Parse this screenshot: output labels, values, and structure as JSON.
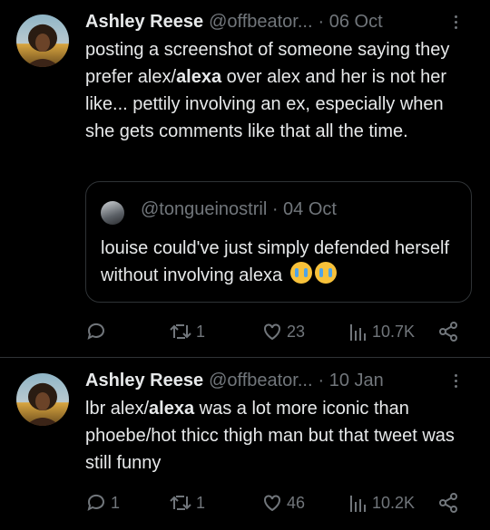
{
  "tweets": [
    {
      "author_name": "Ashley Reese",
      "author_handle": "@offbeator...",
      "date": "· 06 Oct",
      "text_parts": [
        "posting a screenshot of someone saying they prefer alex/",
        "alexa",
        " over alex and her is not her like... pettily involving an ex, especially when she gets comments like that all the time."
      ],
      "quoted": {
        "handle": "@tongueinostril",
        "date": "· 04 Oct",
        "text": "louise could've just simply defended herself without involving alexa",
        "emoji": "loudly-crying-face"
      },
      "actions": {
        "replies": "",
        "retweets": "1",
        "likes": "23",
        "views": "10.7K"
      }
    },
    {
      "author_name": "Ashley Reese",
      "author_handle": "@offbeator...",
      "date": "· 10 Jan",
      "text_parts": [
        "lbr alex/",
        "alexa",
        " was a lot more iconic than phoebe/hot thicc thigh man but that tweet was still funny"
      ],
      "actions": {
        "replies": "1",
        "retweets": "1",
        "likes": "46",
        "views": "10.2K"
      }
    }
  ],
  "icons": [
    "reply-icon",
    "retweet-icon",
    "like-icon",
    "views-icon",
    "share-icon",
    "more-icon"
  ],
  "colors": {
    "background": "#000000",
    "text": "#e7e9ea",
    "secondary": "#71767b",
    "border": "#2f3336"
  }
}
